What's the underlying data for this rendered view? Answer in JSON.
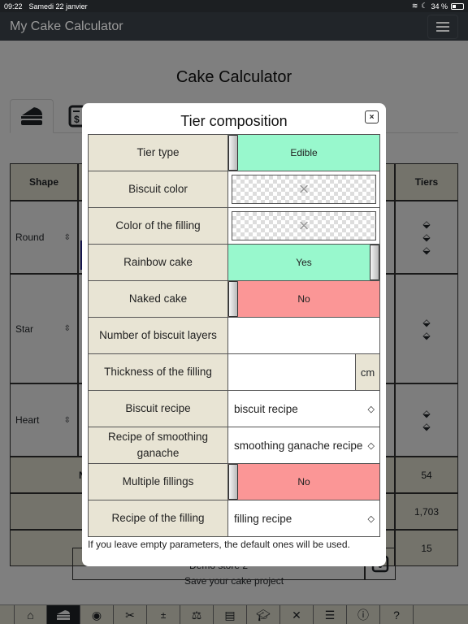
{
  "status_bar": {
    "time": "09:22",
    "date": "Samedi 22 janvier",
    "battery": "34 %"
  },
  "navbar": {
    "brand": "My Cake Calculator",
    "menu_icon": "hamburger-icon"
  },
  "page": {
    "title": "Cake Calculator",
    "tabs": [
      {
        "icon": "cake-slice-icon",
        "active": true
      },
      {
        "icon": "invoice-dollar-icon",
        "active": false
      }
    ]
  },
  "background_table": {
    "headers": {
      "shape": "Shape",
      "tiers": "Tiers"
    },
    "rows": [
      {
        "shape": "Round",
        "swatch": "#2a2a9a"
      },
      {
        "shape": "Star",
        "swatch": "#d8d4a0"
      },
      {
        "shape": "Heart",
        "swatch": "#c02020"
      }
    ],
    "summary": [
      {
        "label": "N",
        "value": "54"
      },
      {
        "label": "",
        "value": "1,703"
      },
      {
        "label": "",
        "value": "15"
      }
    ]
  },
  "save": {
    "label": "Save your cake project",
    "value": "Demo store 2"
  },
  "bottom_nav": [
    {
      "name": "home",
      "icon": "home-icon"
    },
    {
      "name": "cake",
      "icon": "cake-slice-icon",
      "active": true
    },
    {
      "name": "view",
      "icon": "eye-icon"
    },
    {
      "name": "cut",
      "icon": "scissors-icon"
    },
    {
      "name": "calc",
      "icon": "calculator-icon"
    },
    {
      "name": "scale",
      "icon": "balance-scale-icon"
    },
    {
      "name": "book",
      "icon": "book-icon"
    },
    {
      "name": "learn",
      "icon": "graduation-cap-icon"
    },
    {
      "name": "tools",
      "icon": "tools-icon"
    },
    {
      "name": "settings",
      "icon": "sliders-icon"
    },
    {
      "name": "info",
      "icon": "info-icon"
    },
    {
      "name": "help",
      "icon": "help-icon"
    }
  ],
  "modal": {
    "title": "Tier composition",
    "close_label": "×",
    "rows": {
      "tier_type": {
        "label": "Tier type",
        "value": "Edible"
      },
      "biscuit_color": {
        "label": "Biscuit color",
        "value": "×"
      },
      "filling_color": {
        "label": "Color of the filling",
        "value": "×"
      },
      "rainbow": {
        "label": "Rainbow cake",
        "value": "Yes"
      },
      "naked": {
        "label": "Naked cake",
        "value": "No"
      },
      "layers": {
        "label": "Number of biscuit layers",
        "value": ""
      },
      "thickness": {
        "label": "Thickness of the filling",
        "value": "",
        "unit": "cm"
      },
      "biscuit_recipe": {
        "label": "Biscuit recipe",
        "value": "biscuit recipe"
      },
      "ganache_recipe": {
        "label": "Recipe of smoothing ganache",
        "value": "smoothing ganache recipe"
      },
      "multiple_fillings": {
        "label": "Multiple fillings",
        "value": "No"
      },
      "filling_recipe": {
        "label": "Recipe of the filling",
        "value": "filling recipe"
      }
    },
    "note": "If you leave empty parameters, the default ones will be used."
  }
}
